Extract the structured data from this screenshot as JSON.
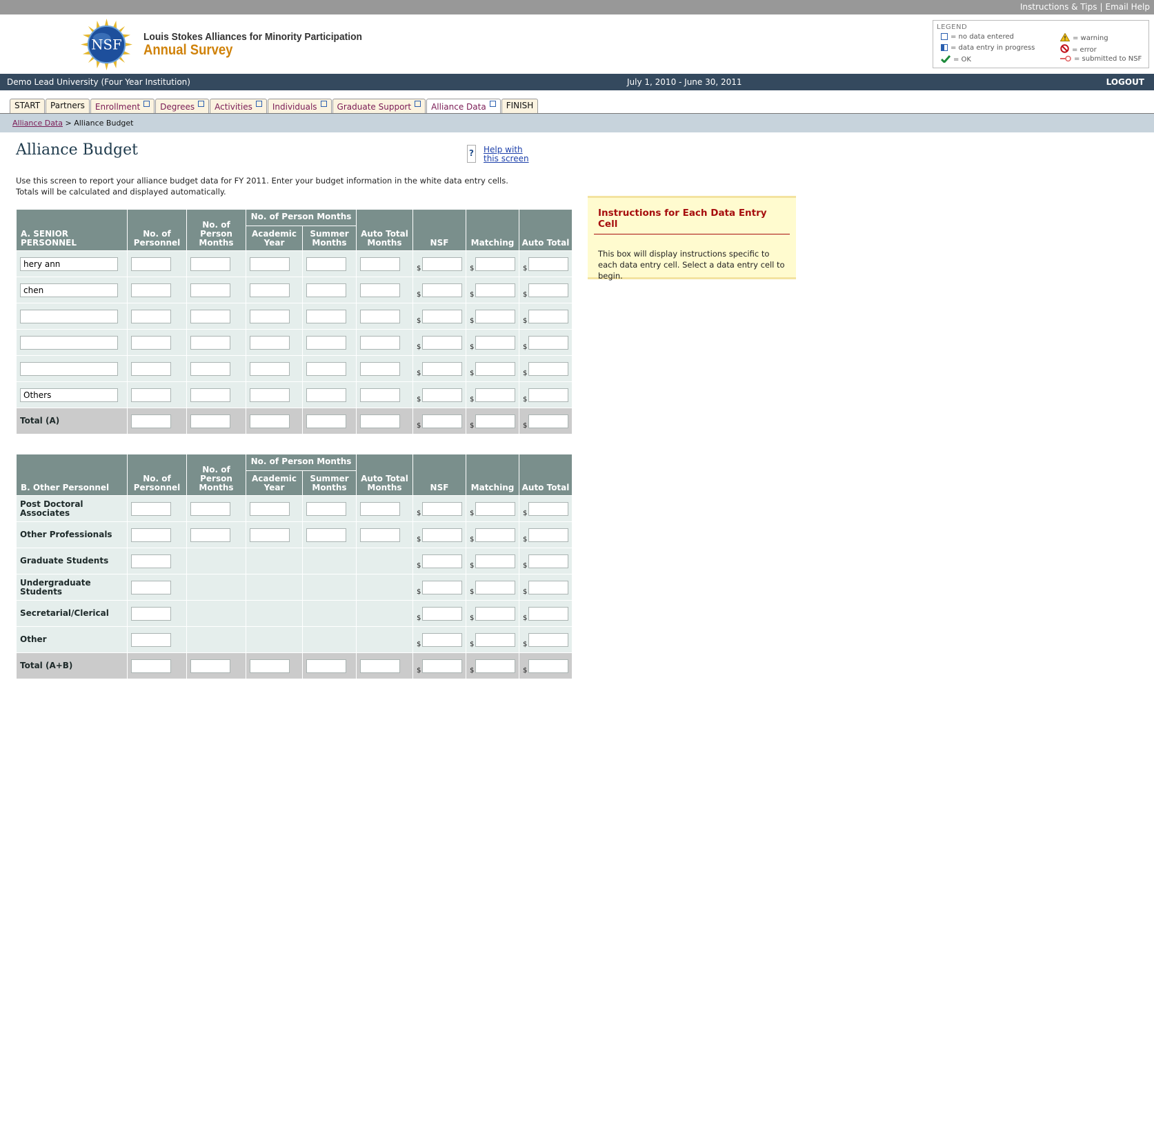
{
  "topbar": {
    "instructions": "Instructions & Tips",
    "sep": "|",
    "email_help": "Email Help"
  },
  "header": {
    "logo_text": "NSF",
    "org_name": "Louis Stokes Alliances for Minority Participation",
    "survey_name": "Annual Survey"
  },
  "legend": {
    "title": "LEGEND",
    "no_data": "= no data entered",
    "in_progress": "= data entry in progress",
    "ok": "= OK",
    "warning": "= warning",
    "error": "= error",
    "submitted": "= submitted to NSF"
  },
  "status": {
    "institution": "Demo Lead University (Four Year Institution)",
    "dates": "July 1, 2010 - June 30, 2011",
    "logout": "LOGOUT"
  },
  "tabs": [
    {
      "label": "START"
    },
    {
      "label": "Partners"
    },
    {
      "label": "Enrollment"
    },
    {
      "label": "Degrees"
    },
    {
      "label": "Activities"
    },
    {
      "label": "Individuals"
    },
    {
      "label": "Graduate Support"
    },
    {
      "label": "Alliance Data"
    },
    {
      "label": "FINISH"
    }
  ],
  "breadcrumb": {
    "parent": "Alliance Data",
    "sep": ">",
    "current": "Alliance Budget"
  },
  "page": {
    "title": "Alliance Budget",
    "help_line1": "Help with",
    "help_line2": "this screen",
    "intro_line1": "Use this screen to report your alliance budget data for FY 2011. Enter your budget information in the white data entry cells.",
    "intro_line2": "Totals will be calculated and displayed automatically."
  },
  "instructions_box": {
    "title": "Instructions for Each Data Entry Cell",
    "text": "This box will display instructions specific to each data entry cell. Select a data entry cell to begin."
  },
  "columns": {
    "no_personnel": "No. of Personnel",
    "no_person_months": "No. of Person Months",
    "group": "No. of Person Months",
    "academic_year": "Academic Year",
    "summer_months": "Summer Months",
    "auto_total_months": "Auto Total Months",
    "nsf": "NSF",
    "matching": "Matching",
    "auto_total": "Auto Total",
    "dollar": "$"
  },
  "section_a": {
    "heading": "A. SENIOR PERSONNEL",
    "rows": [
      {
        "name": "hery ann"
      },
      {
        "name": "chen"
      },
      {
        "name": ""
      },
      {
        "name": ""
      },
      {
        "name": ""
      },
      {
        "name": "Others"
      }
    ],
    "total_label": "Total (A)"
  },
  "section_b": {
    "heading": "B. Other Personnel",
    "rows": [
      {
        "label": "Post Doctoral Associates"
      },
      {
        "label": "Other Professionals"
      },
      {
        "label": "Graduate Students"
      },
      {
        "label": "Undergraduate Students"
      },
      {
        "label": "Secretarial/Clerical"
      },
      {
        "label": "Other"
      }
    ],
    "total_label": "Total (A+B)"
  },
  "colors": {
    "status_bar": "#34495e",
    "table_header": "#7a8f8c",
    "accent_title": "#a60e0e",
    "brand_orange": "#d0820a"
  }
}
